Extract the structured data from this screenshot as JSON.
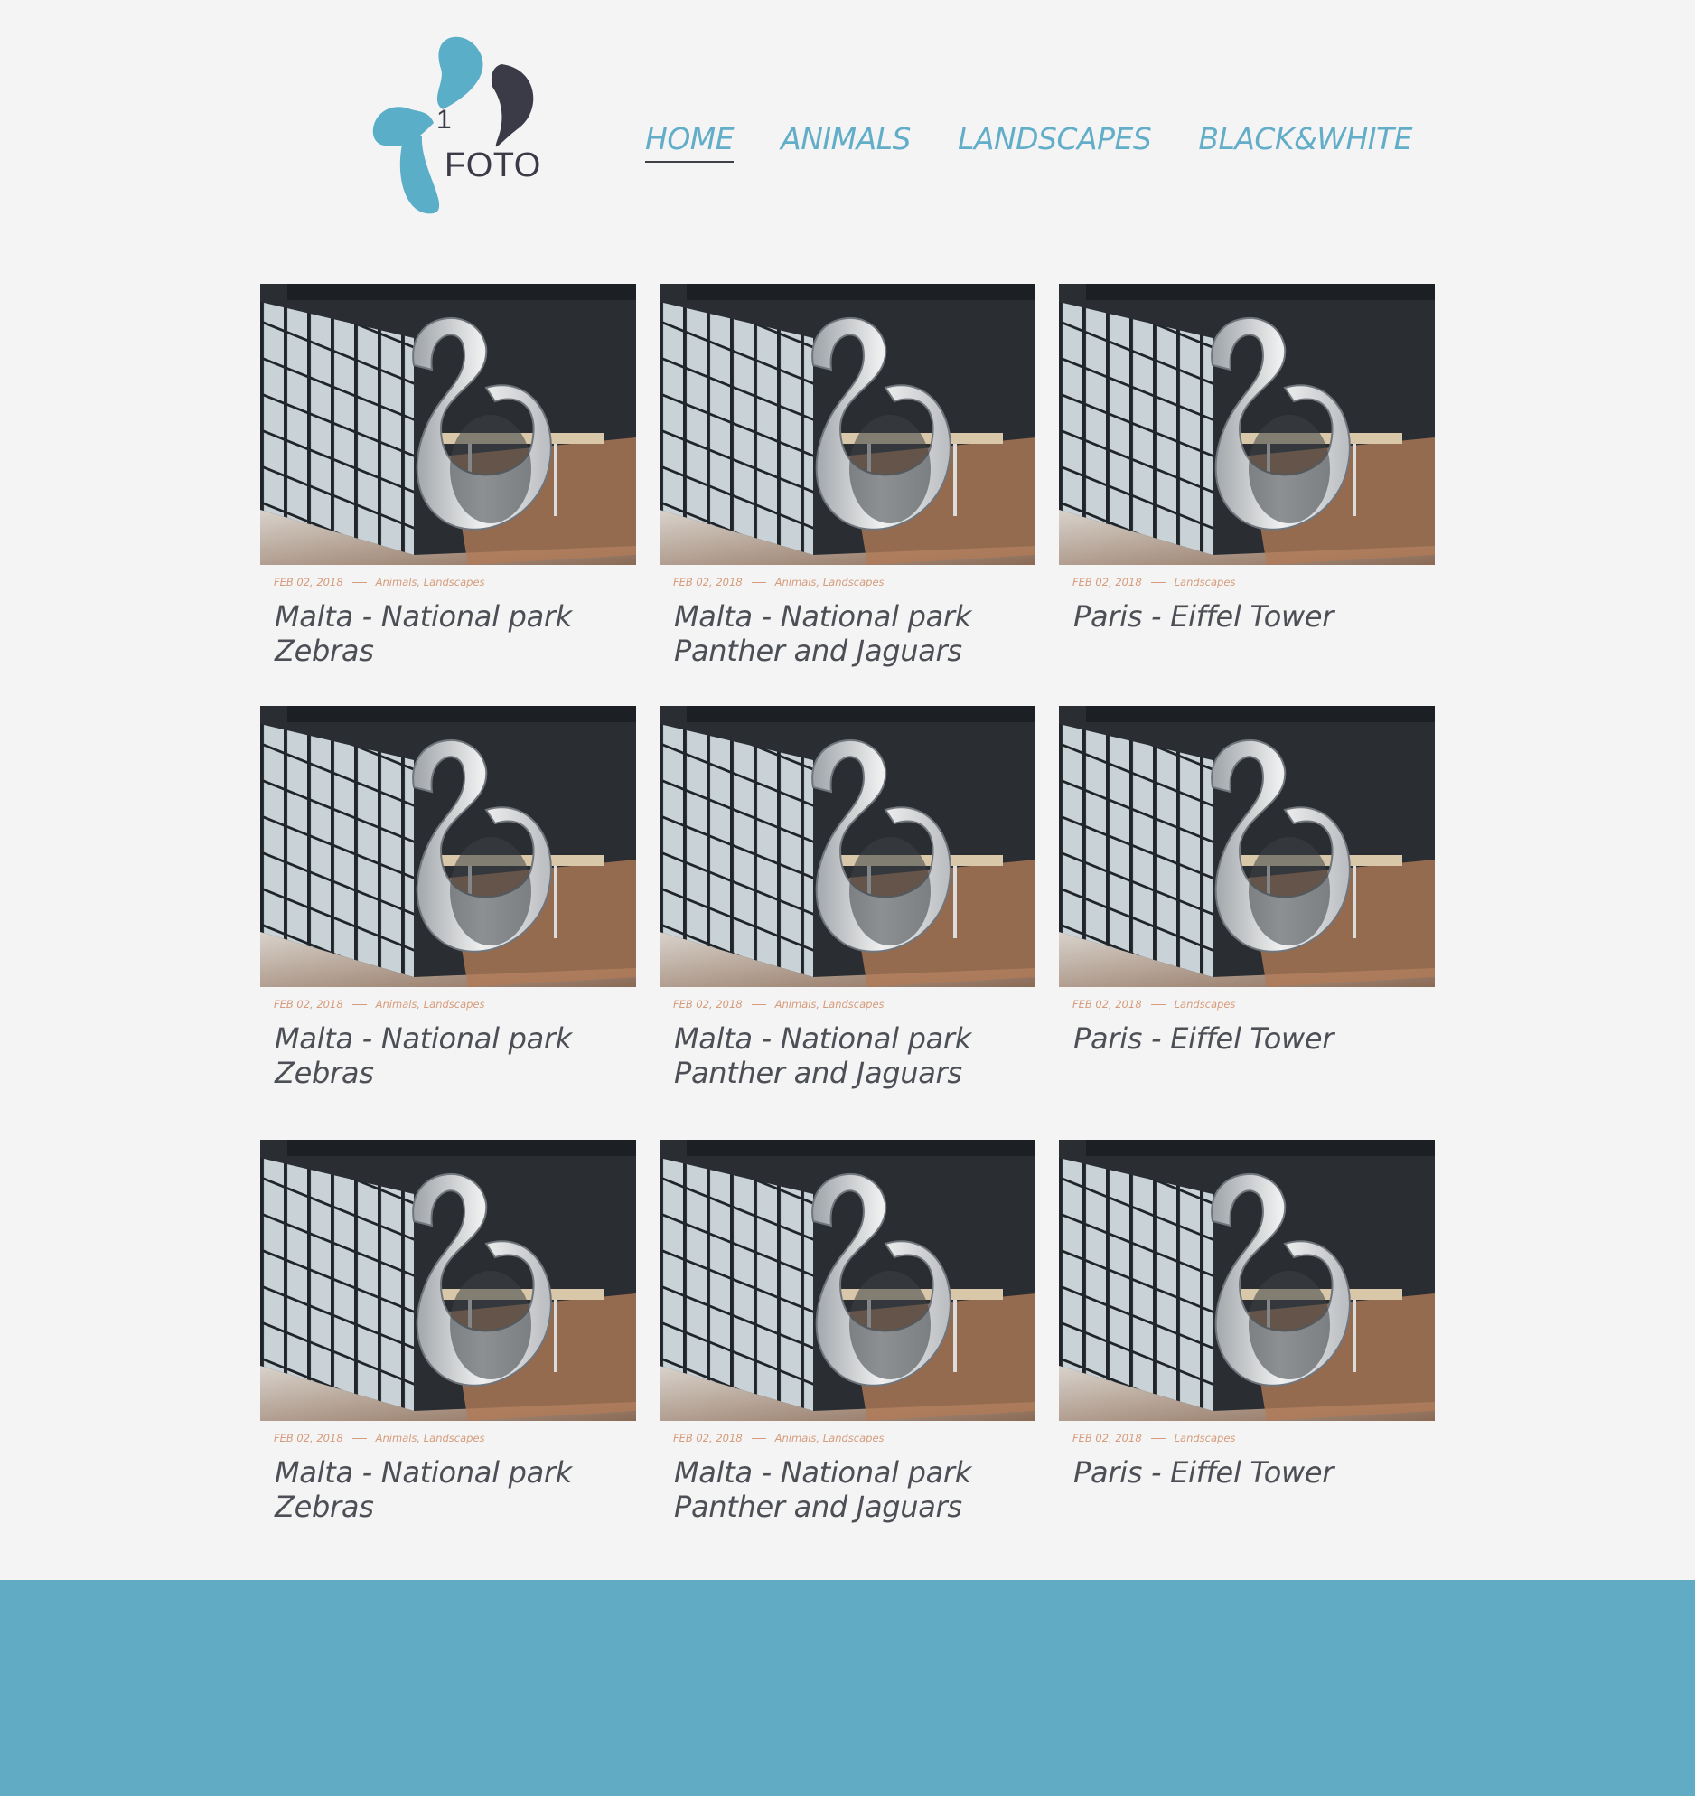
{
  "logo": {
    "number": "1",
    "word": "FOTO"
  },
  "colors": {
    "accent": "#62adc8",
    "dark": "#3b3b48",
    "meta": "#d69b7b",
    "footer": "#62abc4",
    "background": "#f4f4f4"
  },
  "nav": {
    "items": [
      {
        "label": "HOME",
        "active": true
      },
      {
        "label": "ANIMALS",
        "active": false
      },
      {
        "label": "LANDSCAPES",
        "active": false
      },
      {
        "label": "BLACK&WHITE",
        "active": false
      }
    ]
  },
  "posts": [
    {
      "date": "FEB 02, 2018",
      "tags": "Animals, Landscapes",
      "title": "Malta - National park Zebras"
    },
    {
      "date": "FEB 02, 2018",
      "tags": "Animals, Landscapes",
      "title": "Malta - National park Panther and Jaguars"
    },
    {
      "date": "FEB 02, 2018",
      "tags": "Landscapes",
      "title": "Paris - Eiffel Tower"
    },
    {
      "date": "FEB 02, 2018",
      "tags": "Animals, Landscapes",
      "title": "Malta - National park Zebras"
    },
    {
      "date": "FEB 02, 2018",
      "tags": "Animals, Landscapes",
      "title": "Malta - National park Panther and Jaguars"
    },
    {
      "date": "FEB 02, 2018",
      "tags": "Landscapes",
      "title": "Paris - Eiffel Tower"
    },
    {
      "date": "FEB 02, 2018",
      "tags": "Animals, Landscapes",
      "title": "Malta - National park Zebras"
    },
    {
      "date": "FEB 02, 2018",
      "tags": "Animals, Landscapes",
      "title": "Malta - National park Panther and Jaguars"
    },
    {
      "date": "FEB 02, 2018",
      "tags": "Landscapes",
      "title": "Paris - Eiffel Tower"
    }
  ]
}
